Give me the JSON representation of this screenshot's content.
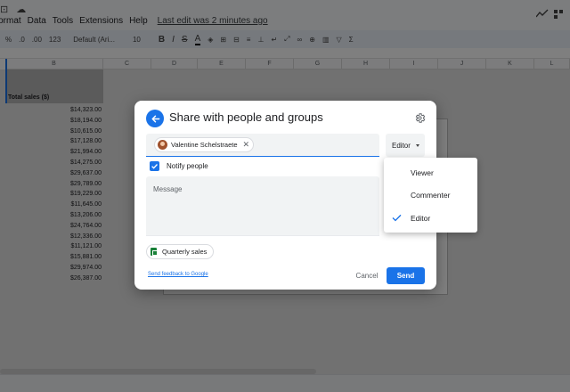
{
  "spreadsheet": {
    "menu": [
      "Format",
      "Data",
      "Tools",
      "Extensions",
      "Help"
    ],
    "last_edit": "Last edit was 2 minutes ago",
    "toolbar": {
      "percent": "%",
      "decrease_decimal": ".0",
      "increase_decimal": ".00",
      "number_format": "123",
      "font": "Default (Ari...",
      "font_size": "10",
      "bold": "B",
      "italic": "I",
      "strikethrough": "S",
      "text_color": "A"
    },
    "columns": [
      "B",
      "C",
      "D",
      "E",
      "F",
      "G",
      "H",
      "I",
      "J",
      "K",
      "L"
    ],
    "header_cell": "Total sales ($)",
    "sales": [
      "$14,323.00",
      "$18,194.00",
      "$10,615.00",
      "$17,128.00",
      "$21,994.00",
      "$14,275.00",
      "$29,637.00",
      "$29,789.00",
      "$19,229.00",
      "$11,645.00",
      "$13,206.00",
      "$24,764.00",
      "$12,336.00",
      "$11,121.00",
      "$15,881.00",
      "$29,974.00",
      "$26,387.00"
    ]
  },
  "dialog": {
    "title": "Share with people and groups",
    "recipient": "Valentine Schelstraete",
    "role": "Editor",
    "notify_label": "Notify people",
    "message_placeholder": "Message",
    "file_name": "Quarterly sales",
    "feedback_link": "Send feedback to Google",
    "cancel_label": "Cancel",
    "send_label": "Send"
  },
  "role_menu": {
    "items": [
      "Viewer",
      "Commenter",
      "Editor"
    ],
    "selected": "Editor"
  },
  "colors": {
    "accent": "#1a73e8",
    "sheets_green": "#188038"
  }
}
